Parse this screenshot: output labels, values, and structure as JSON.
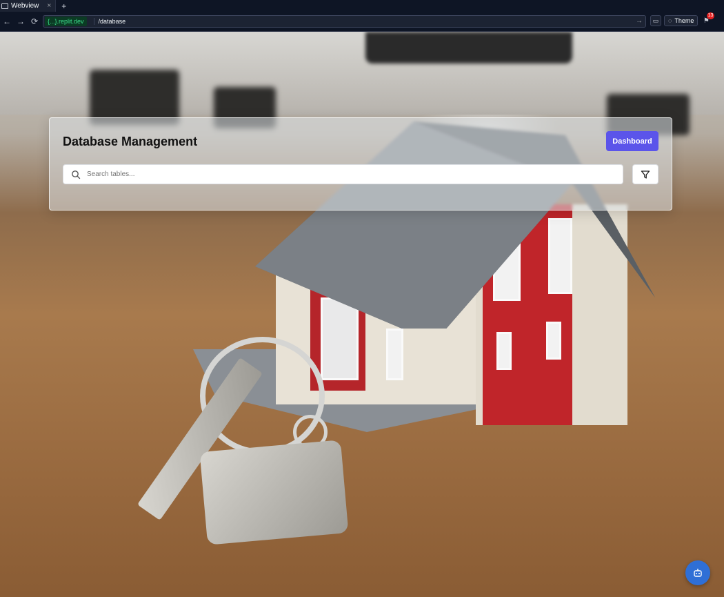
{
  "browser": {
    "tab_title": "Webview",
    "tab_close": "×",
    "new_tab": "+",
    "domain": "{...}.replit.dev",
    "path": "/database",
    "theme_label": "Theme",
    "notification_count": "13"
  },
  "page": {
    "title": "Database Management",
    "dashboard_button": "Dashboard",
    "search_placeholder": "Search tables..."
  },
  "colors": {
    "accent": "#5b54ea",
    "bot_button": "#2f6fd6"
  },
  "icons": {
    "search": "search-icon",
    "filter": "filter-icon",
    "bot": "bot-icon"
  }
}
